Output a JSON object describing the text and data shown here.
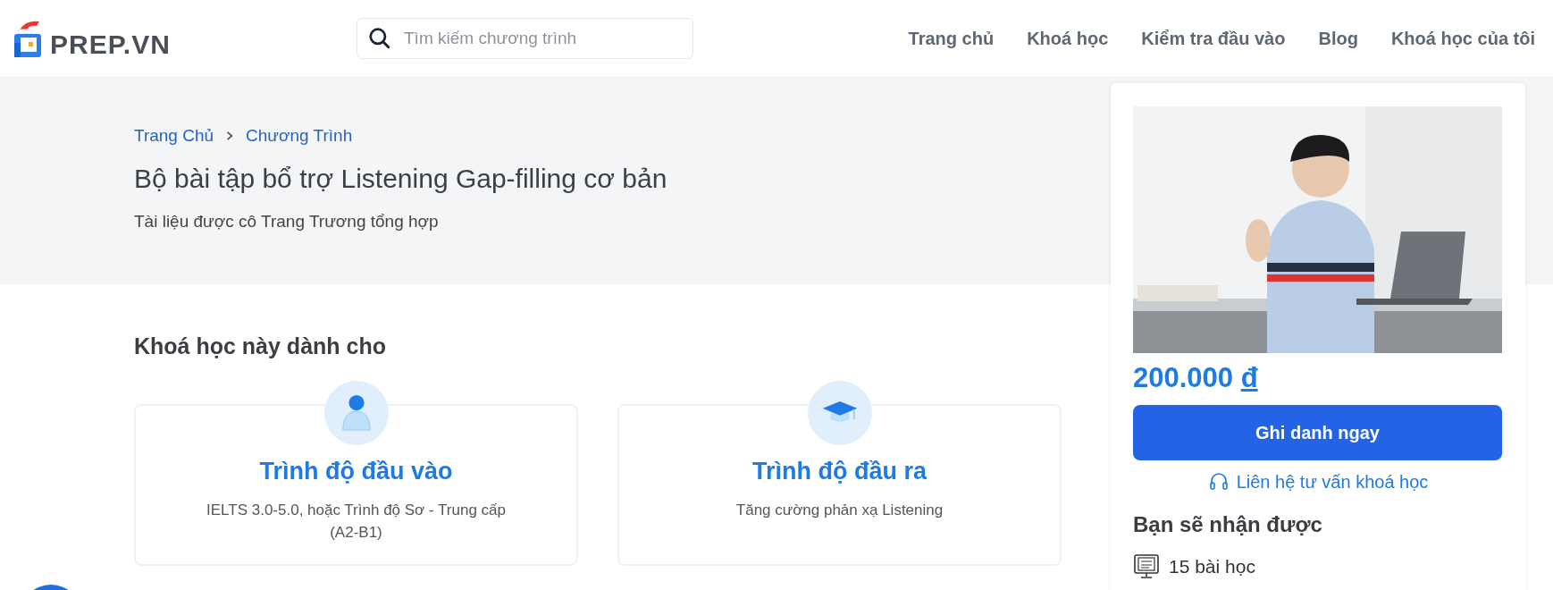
{
  "header": {
    "logo": "PREP.VN",
    "search": {
      "placeholder": "Tìm kiếm chương trình"
    },
    "nav": [
      {
        "label": "Trang chủ"
      },
      {
        "label": "Khoá học"
      },
      {
        "label": "Kiểm tra đầu vào"
      },
      {
        "label": "Blog"
      },
      {
        "label": "Khoá học của tôi"
      }
    ]
  },
  "breadcrumb": [
    "Trang Chủ",
    "Chương Trình"
  ],
  "title": "Bộ bài tập bổ trợ Listening Gap-filling cơ bản",
  "subtitle": "Tài liệu được cô Trang Trương tổng hợp",
  "audience": {
    "heading": "Khoá học này dành cho",
    "cards": [
      {
        "kind": "person",
        "title": "Trình độ đầu vào",
        "text": "IELTS 3.0-5.0, hoặc Trình độ Sơ - Trung cấp (A2-B1)"
      },
      {
        "kind": "graduation",
        "title": "Trình độ đầu ra",
        "text": "Tăng cường phản xạ Listening"
      }
    ]
  },
  "sidebar": {
    "price": "200.000",
    "currency": "đ",
    "enroll_button": "Ghi danh ngay",
    "contact_link": "Liên hệ tư vấn khoá học",
    "benefits_heading": "Bạn sẽ nhận được",
    "benefits": [
      {
        "label": "15 bài học"
      }
    ]
  }
}
